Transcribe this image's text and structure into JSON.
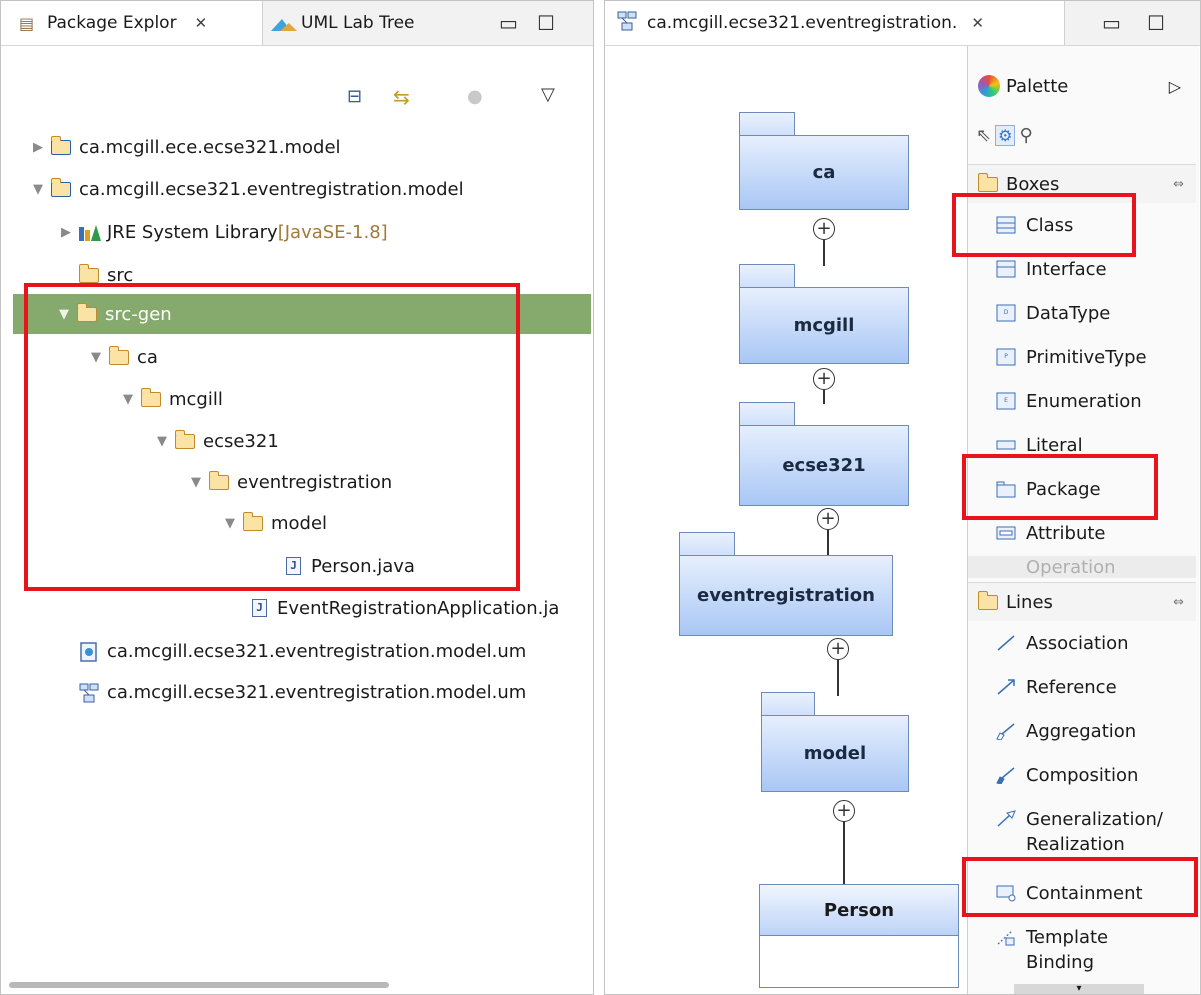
{
  "left_panel": {
    "tabs": [
      {
        "label": "Package Explor"
      },
      {
        "label": "UML Lab Tree"
      }
    ],
    "tree": [
      {
        "label": "ca.mcgill.ece.ecse321.model",
        "suffix": ""
      },
      {
        "label": "ca.mcgill.ecse321.eventregistration.model",
        "suffix": ""
      },
      {
        "label": "JRE System Library ",
        "suffix": "[JavaSE-1.8]"
      },
      {
        "label": "src",
        "suffix": ""
      },
      {
        "label": "src-gen",
        "suffix": ""
      },
      {
        "label": "ca",
        "suffix": ""
      },
      {
        "label": "mcgill",
        "suffix": ""
      },
      {
        "label": "ecse321",
        "suffix": ""
      },
      {
        "label": "eventregistration",
        "suffix": ""
      },
      {
        "label": "model",
        "suffix": ""
      },
      {
        "label": "Person.java",
        "suffix": ""
      },
      {
        "label": "EventRegistrationApplication.ja",
        "suffix": ""
      },
      {
        "label": "ca.mcgill.ecse321.eventregistration.model.um",
        "suffix": ""
      },
      {
        "label": "ca.mcgill.ecse321.eventregistration.model.um",
        "suffix": ""
      }
    ]
  },
  "editor": {
    "tab_label": "ca.mcgill.ecse321.eventregistration.",
    "packages": [
      "ca",
      "mcgill",
      "ecse321",
      "eventregistration",
      "model"
    ],
    "class_name": "Person"
  },
  "palette": {
    "title": "Palette",
    "boxes_header": "Boxes",
    "boxes": [
      "Class",
      "Interface",
      "DataType",
      "PrimitiveType",
      "Enumeration",
      "Literal",
      "Package",
      "Attribute",
      "Operation"
    ],
    "lines_header": "Lines",
    "lines": [
      "Association",
      "Reference",
      "Aggregation",
      "Composition",
      "Generalization/",
      "Realization",
      "Containment",
      "Template",
      "Binding"
    ]
  },
  "colors": {
    "selection": "#86a96d",
    "highlight": "#e8141c",
    "package_fill": "#a9c7f5"
  }
}
